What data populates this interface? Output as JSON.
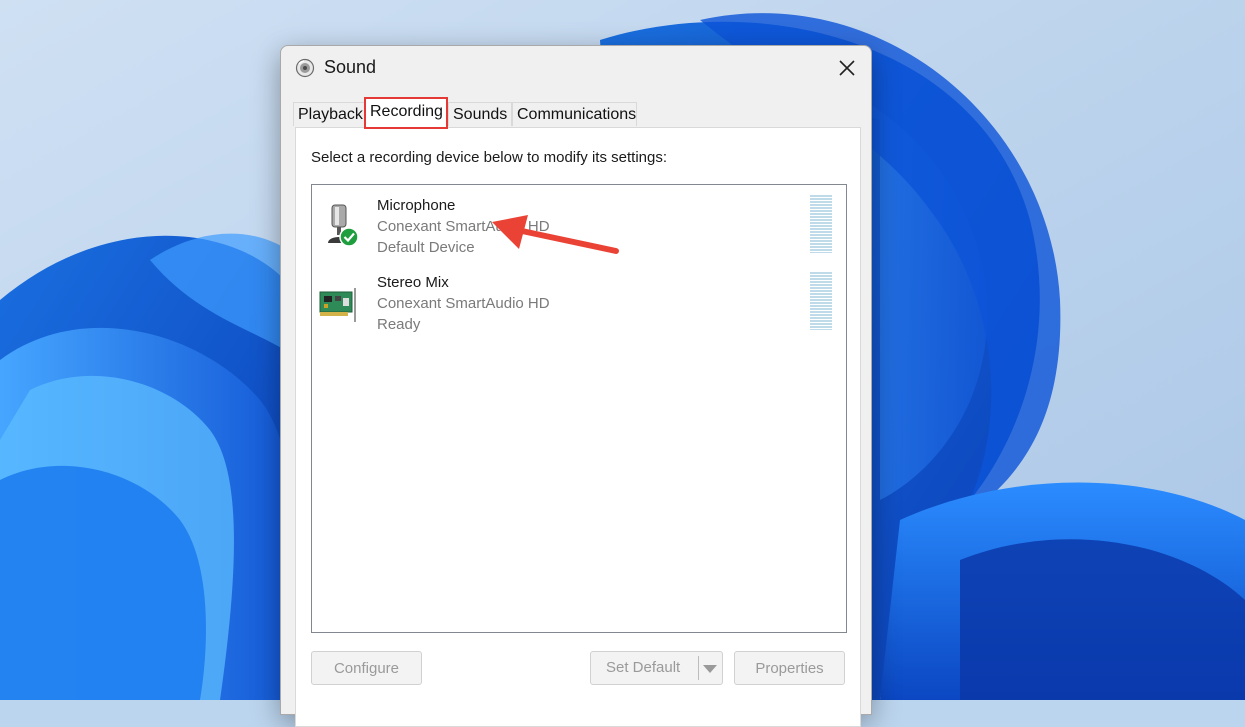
{
  "window": {
    "title": "Sound",
    "title_icon": "speaker-icon",
    "close_icon": "close-icon"
  },
  "tabs": [
    {
      "label": "Playback",
      "active": false
    },
    {
      "label": "Recording",
      "active": true
    },
    {
      "label": "Sounds",
      "active": false
    },
    {
      "label": "Communications",
      "active": false
    }
  ],
  "instruction": "Select a recording device below to modify its settings:",
  "devices": [
    {
      "name": "Microphone",
      "driver": "Conexant SmartAudio HD",
      "status": "Default Device",
      "icon": "microphone-icon",
      "badge": "checkmark-badge-icon"
    },
    {
      "name": "Stereo Mix",
      "driver": "Conexant SmartAudio HD",
      "status": "Ready",
      "icon": "sound-card-icon"
    }
  ],
  "buttons": {
    "configure": "Configure",
    "set_default": "Set Default",
    "properties": "Properties"
  },
  "colors": {
    "highlight": "#e53935",
    "arrow": "#ea4335",
    "check_badge": "#1e9e3e",
    "level_meter": "#bfdbea"
  }
}
